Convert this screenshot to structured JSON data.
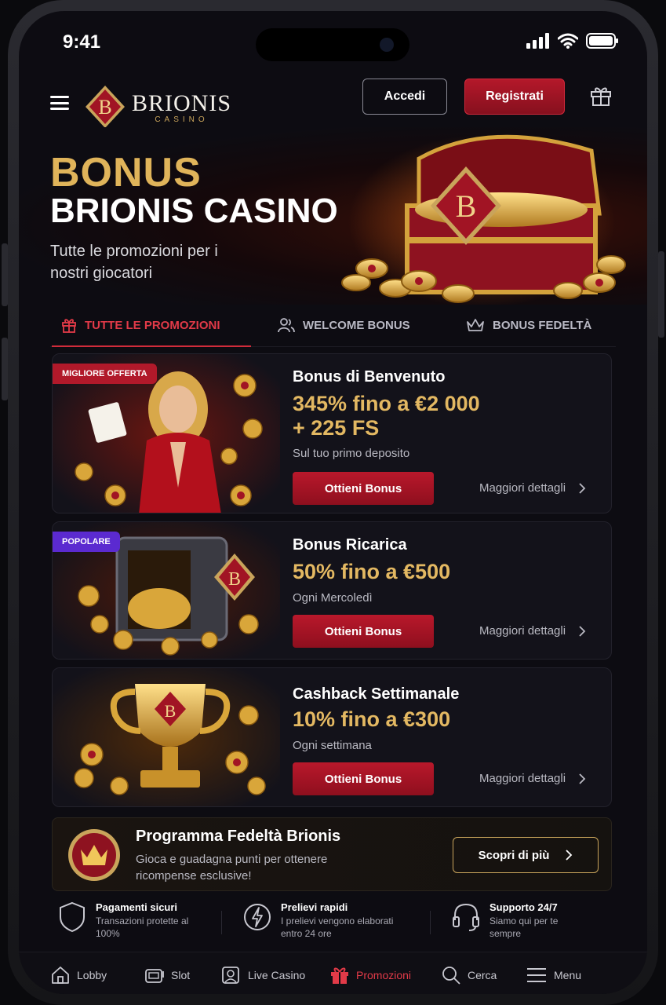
{
  "status_bar": {
    "time": "9:41"
  },
  "header": {
    "logo_name": "BRIONIS",
    "logo_sub": "CASINO",
    "logo_letter": "B",
    "login_label": "Accedi",
    "register_label": "Registrati"
  },
  "hero": {
    "title_line1": "BONUS",
    "title_line2": "BRIONIS CASINO",
    "subtitle": "Tutte le promozioni per i nostri giocatori"
  },
  "tabs": [
    {
      "label": "TUTTE LE PROMOZIONI",
      "icon": "gift-icon",
      "active": true
    },
    {
      "label": "WELCOME BONUS",
      "icon": "users-icon",
      "active": false
    },
    {
      "label": "BONUS FEDELTÀ",
      "icon": "crown-icon",
      "active": false
    }
  ],
  "promos": [
    {
      "badge": "MIGLIORE OFFERTA",
      "title": "Bonus di Benvenuto",
      "amount_line1": "345% fino a €2 000",
      "amount_line2": "+ 225 FS",
      "desc": "Sul tuo primo deposito",
      "button": "Ottieni Bonus",
      "details": "Maggiori dettagli"
    },
    {
      "badge": "POPOLARE",
      "title": "Bonus Ricarica",
      "amount_line1": "50% fino a €500",
      "desc": "Ogni Mercoledì",
      "button": "Ottieni Bonus",
      "details": "Maggiori dettagli"
    },
    {
      "title": "Cashback Settimanale",
      "amount_line1": "10% fino a €300",
      "desc": "Ogni settimana",
      "button": "Ottieni Bonus",
      "details": "Maggiori dettagli"
    }
  ],
  "loyalty": {
    "title": "Programma Fedeltà Brionis",
    "desc": "Gioca e guadagna punti per ottenere ricompense esclusive!",
    "button": "Scopri di più"
  },
  "features": [
    {
      "title": "Pagamenti sicuri",
      "desc": "Transazioni protette al 100%",
      "icon": "shield-icon"
    },
    {
      "title": "Prelievi rapidi",
      "desc": "I prelievi vengono elaborati entro 24 ore",
      "icon": "lightning-icon"
    },
    {
      "title": "Supporto 24/7",
      "desc": "Siamo qui per te sempre",
      "icon": "headset-icon"
    }
  ],
  "bottom_nav": [
    {
      "label": "Lobby",
      "icon": "home-icon"
    },
    {
      "label": "Slot",
      "icon": "slot-icon"
    },
    {
      "label": "Live Casino",
      "icon": "live-casino-icon"
    },
    {
      "label": "Promozioni",
      "icon": "gift-icon",
      "active": true
    },
    {
      "label": "Cerca",
      "icon": "search-icon"
    },
    {
      "label": "Menu",
      "icon": "menu-icon"
    }
  ],
  "colors": {
    "accent_red": "#b1192a",
    "gold": "#e0b45a",
    "background": "#0d0c12",
    "card": "#13121a",
    "badge_purple": "#5b2ad0"
  }
}
